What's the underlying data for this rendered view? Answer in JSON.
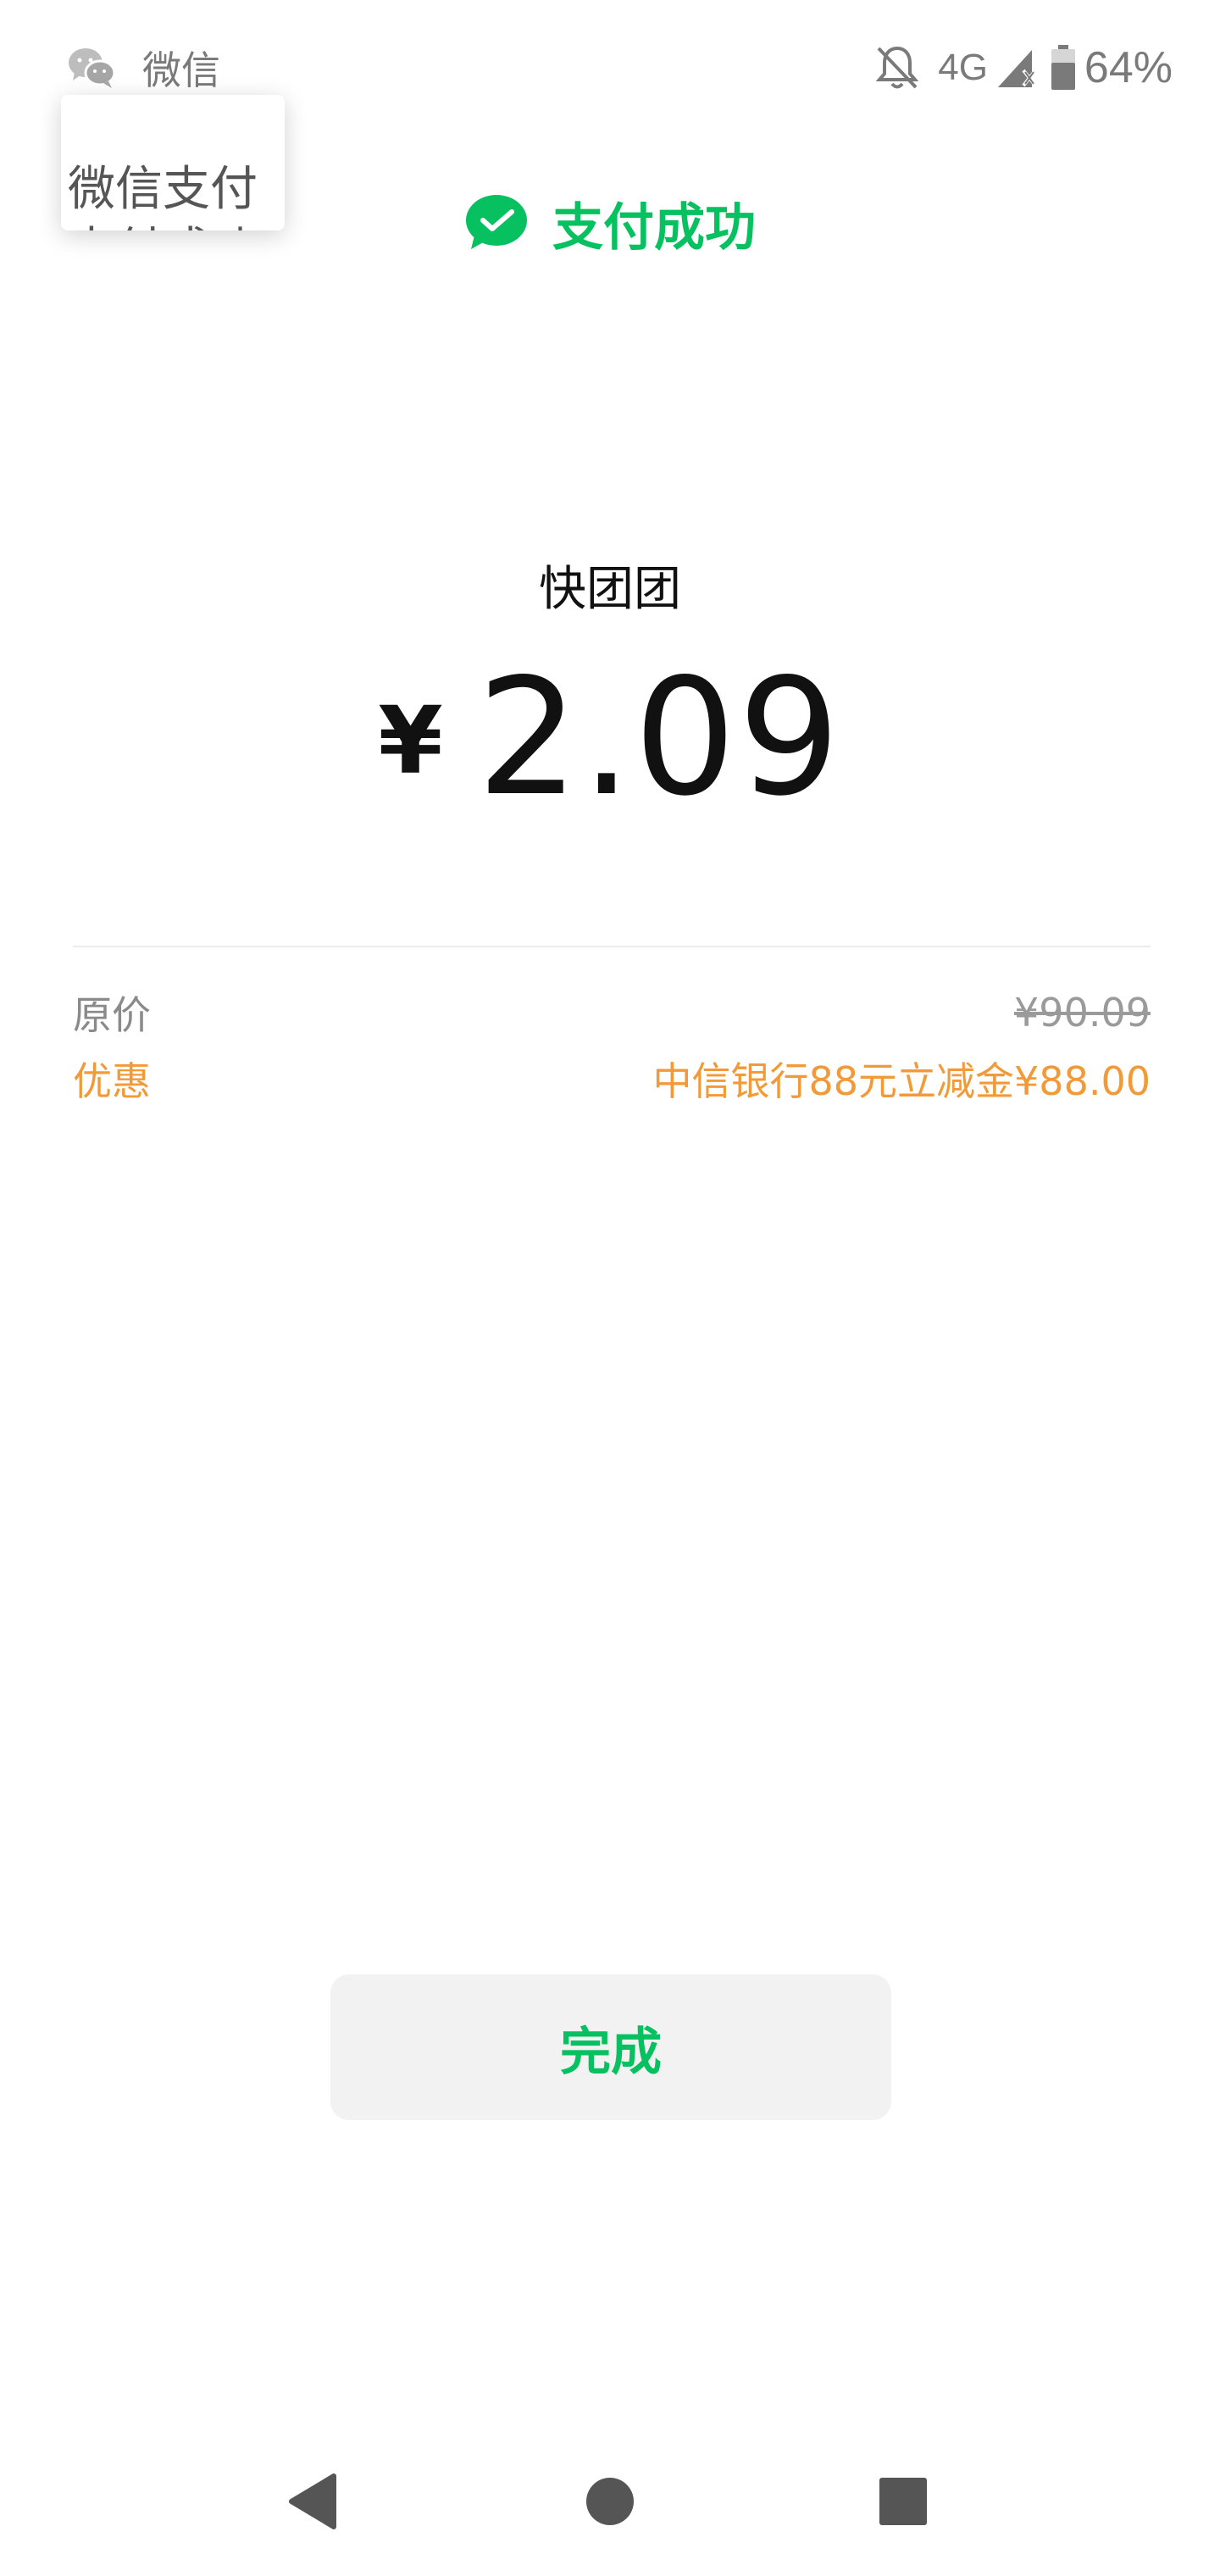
{
  "status_bar": {
    "app_icon": "wechat-icon",
    "app_name": "微信",
    "icons": [
      "bell-off-icon",
      "signal-icon",
      "battery-icon"
    ],
    "network": "4G",
    "battery": "64%"
  },
  "tooltip": {
    "text": "微信支付",
    "subtext": "支付成功"
  },
  "header": {
    "icon": "check-circle-icon",
    "title": "支付成功"
  },
  "payment": {
    "merchant": "快团团",
    "currency": "¥",
    "amount": "2.09"
  },
  "details": {
    "original_label": "原价",
    "original_value": "¥90.09",
    "discount_label": "优惠",
    "discount_value": "中信银行88元立减金¥88.00"
  },
  "actions": {
    "done_label": "完成"
  },
  "nav": {
    "icons": [
      "back-icon",
      "home-icon",
      "recents-icon"
    ]
  },
  "colors": {
    "brand_green": "#07c160",
    "discount_orange": "#f29a38",
    "muted_text": "#8a8a8a",
    "button_bg": "#f2f2f2"
  }
}
